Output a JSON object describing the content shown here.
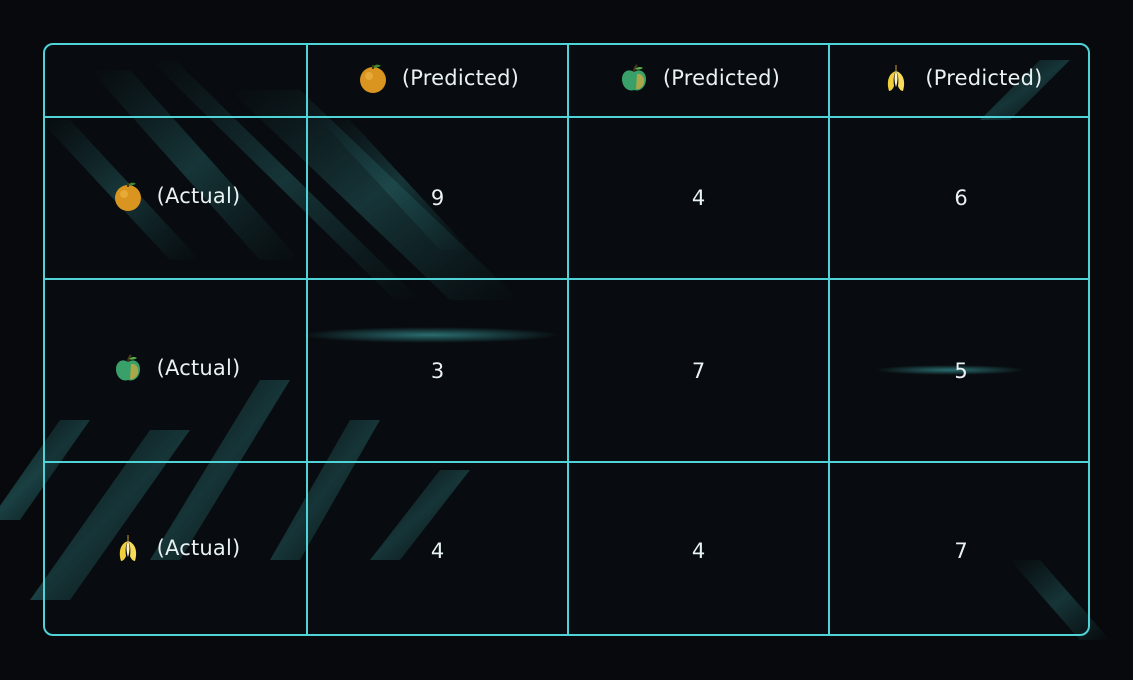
{
  "matrix": {
    "columns": [
      {
        "icon": "orange-icon",
        "label": "(Predicted)"
      },
      {
        "icon": "apple-icon",
        "label": "(Predicted)"
      },
      {
        "icon": "banana-icon",
        "label": "(Predicted)"
      }
    ],
    "rows": [
      {
        "icon": "orange-icon",
        "label": "(Actual)",
        "values": [
          "9",
          "4",
          "6"
        ]
      },
      {
        "icon": "apple-icon",
        "label": "(Actual)",
        "values": [
          "3",
          "7",
          "5"
        ]
      },
      {
        "icon": "banana-icon",
        "label": "(Actual)",
        "values": [
          "4",
          "4",
          "7"
        ]
      }
    ]
  },
  "colors": {
    "grid_line": "#4fd3d6",
    "text": "#e9f2f3",
    "background": "#07090c"
  }
}
